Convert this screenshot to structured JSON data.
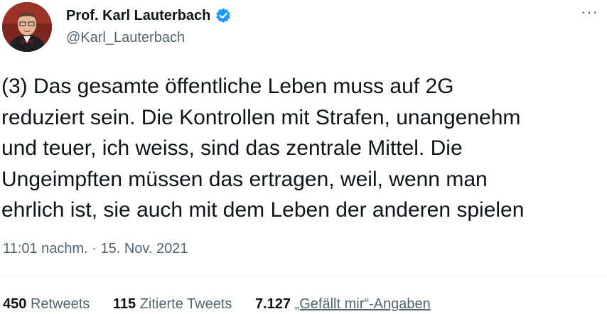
{
  "author": {
    "display_name": "Prof. Karl Lauterbach",
    "handle": "@Karl_Lauterbach",
    "verified": true
  },
  "tweet": {
    "text": "(3) Das gesamte öffentliche Leben muss auf 2G\nreduziert sein. Die Kontrollen mit Strafen, unangenehm\nund teuer, ich weiss, sind das zentrale Mittel. Die\nUngeimpften müssen das ertragen, weil, wenn man\nehrlich ist, sie auch mit dem Leben der anderen spielen",
    "timestamp": "11:01 nachm. · 15. Nov. 2021"
  },
  "stats": {
    "retweets": {
      "count": "450",
      "label": "Retweets"
    },
    "quotes": {
      "count": "115",
      "label": "Zitierte Tweets"
    },
    "likes": {
      "count": "7.127",
      "label": "„Gefällt mir“-Angaben"
    }
  },
  "colors": {
    "text": "#0f1419",
    "secondary": "#536471",
    "verified": "#1d9bf0",
    "divider": "#eff3f4"
  },
  "icons": {
    "verified": "verified-badge-icon",
    "more": "more-options-icon"
  }
}
